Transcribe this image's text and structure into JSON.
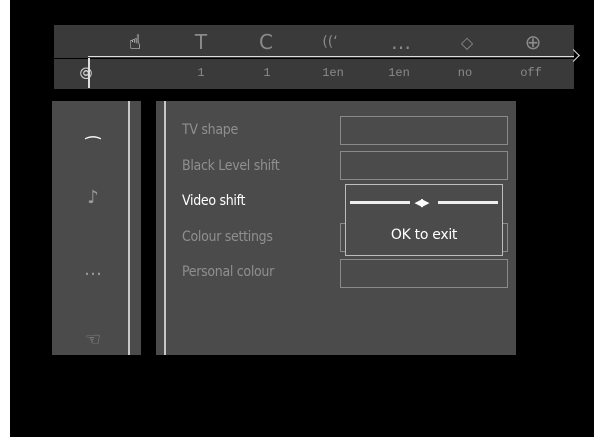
{
  "toolbar": {
    "icons": [
      "camera-angle-icon",
      "title-icon",
      "chapter-icon",
      "audio-icon",
      "subtitle-icon",
      "angle-icon",
      "zoom-icon"
    ],
    "glyphs": {
      "camera": "☝",
      "title": "T",
      "chapter": "C",
      "audio": "((‘",
      "subtitle": "…",
      "angle": "◇",
      "zoom": "⊕"
    }
  },
  "status": {
    "disc_glyph": "⦾",
    "values": [
      "1",
      "1",
      "1en",
      "1en",
      "no",
      "off"
    ]
  },
  "tabs": {
    "picture": "⁔",
    "sound": "♪",
    "language": "…",
    "features": "☜"
  },
  "menu": {
    "items": [
      {
        "label": "TV shape",
        "active": false
      },
      {
        "label": "Black Level shift",
        "active": false
      },
      {
        "label": "Video shift",
        "active": true
      },
      {
        "label": "Colour settings",
        "active": false
      },
      {
        "label": "Personal colour",
        "active": false
      }
    ]
  },
  "popup": {
    "knob": "◀▶",
    "exit_text": "OK to exit"
  }
}
